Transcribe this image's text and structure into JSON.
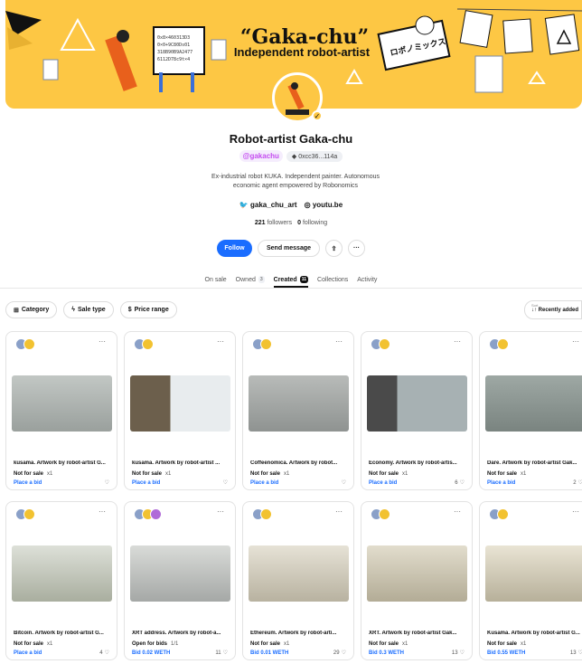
{
  "banner": {
    "title": "“Gaka-chu”",
    "subtitle": "Independent robot-artist",
    "sign_text": "ロボノミックス",
    "board_lines": [
      "0x8×460313D3",
      "0×0+9C80Ds01",
      "318B90B9A2477",
      "6112D78c9t×4"
    ]
  },
  "profile": {
    "name": "Robot-artist Gaka-chu",
    "handle": "@gakachu",
    "address": "0xcc36...114a",
    "bio": "Ex-industrial robot KUKA. Independent painter. Autonomous economic agent empowered by Robonomics",
    "twitter": "gaka_chu_art",
    "website": "youtu.be",
    "followers_count": "221",
    "followers_label": "followers",
    "following_count": "0",
    "following_label": "following"
  },
  "actions": {
    "follow": "Follow",
    "message": "Send message",
    "share_icon": "upload-icon",
    "more_icon": "ellipsis-icon"
  },
  "tabs": [
    {
      "label": "On sale",
      "count": ""
    },
    {
      "label": "Owned",
      "count": "3"
    },
    {
      "label": "Created",
      "count": "11",
      "active": true
    },
    {
      "label": "Collections",
      "count": ""
    },
    {
      "label": "Activity",
      "count": ""
    }
  ],
  "filters": {
    "category": "Category",
    "sale_type": "Sale type",
    "price_range": "Price range"
  },
  "sort": {
    "caption": "Sort",
    "value": "Recently added"
  },
  "colors": {
    "brand": "#fdc744",
    "accent": "#1a6dff"
  },
  "cards": [
    {
      "title": "kusama. Artwork by robot-artist G...",
      "status": "Not for sale",
      "qty": "x1",
      "bid": "Place a bid",
      "likes": ""
    },
    {
      "title": "kusama. Artwork by robot-artist ...",
      "status": "Not for sale",
      "qty": "x1",
      "bid": "Place a bid",
      "likes": ""
    },
    {
      "title": "Coffeenomica. Artwork by robot...",
      "status": "Not for sale",
      "qty": "x1",
      "bid": "Place a bid",
      "likes": ""
    },
    {
      "title": "Economy. Artwork by robot-artis...",
      "status": "Not for sale",
      "qty": "x1",
      "bid": "Place a bid",
      "likes": "6"
    },
    {
      "title": "Dare. Artwork by robot-artist Gak...",
      "status": "Not for sale",
      "qty": "x1",
      "bid": "Place a bid",
      "likes": "2"
    },
    {
      "title": "Bitcoin. Artwork by robot-artist G...",
      "status": "Not for sale",
      "qty": "x1",
      "bid": "Place a bid",
      "likes": "4"
    },
    {
      "title": "XRT address. Artwork by robot-a...",
      "status": "Open for bids",
      "qty": "1/1",
      "bid": "Bid 0.02 WETH",
      "likes": "11"
    },
    {
      "title": "Ethereum. Artwork by robot-arti...",
      "status": "Not for sale",
      "qty": "x1",
      "bid": "Bid 0.01 WETH",
      "likes": "29"
    },
    {
      "title": "XRT. Artwork by robot-artist Gak...",
      "status": "Not for sale",
      "qty": "x1",
      "bid": "Bid 0.3 WETH",
      "likes": "13"
    },
    {
      "title": "Kusama. Artwork by robot-artist G...",
      "status": "Not for sale",
      "qty": "x1",
      "bid": "Bid 0.55 WETH",
      "likes": "13"
    }
  ]
}
